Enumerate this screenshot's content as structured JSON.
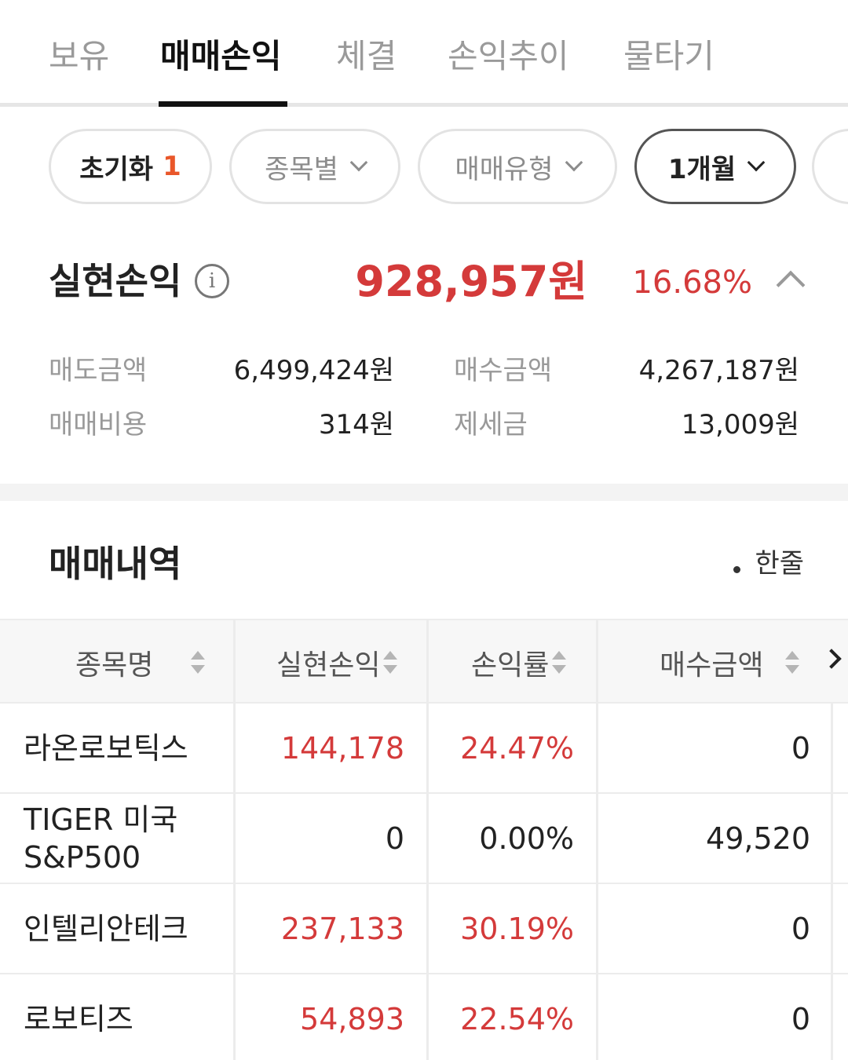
{
  "tabs": [
    {
      "label": "보유"
    },
    {
      "label": "매매손익"
    },
    {
      "label": "체결"
    },
    {
      "label": "손익추이"
    },
    {
      "label": "물타기"
    }
  ],
  "filters": {
    "reset_label": "초기화",
    "reset_count": "1",
    "by_stock": "종목별",
    "trade_type": "매매유형",
    "period": "1개월"
  },
  "summary": {
    "label": "실현손익",
    "info_glyph": "i",
    "amount": "928,957원",
    "rate": "16.68%",
    "sell_amount_label": "매도금액",
    "sell_amount": "6,499,424원",
    "buy_amount_label": "매수금액",
    "buy_amount": "4,267,187원",
    "fee_label": "매매비용",
    "fee": "314원",
    "tax_label": "제세금",
    "tax": "13,009원"
  },
  "history": {
    "title": "매매내역",
    "view_toggle": "한줄",
    "columns": [
      "종목명",
      "실현손익",
      "손익률",
      "매수금액"
    ],
    "rows": [
      {
        "name": "라온로보틱스",
        "profit": "144,178",
        "rate": "24.47%",
        "buy": "0"
      },
      {
        "name": "TIGER 미국S&P500",
        "profit": "0",
        "rate": "0.00%",
        "buy": "49,520"
      },
      {
        "name": "인텔리안테크",
        "profit": "237,133",
        "rate": "30.19%",
        "buy": "0"
      },
      {
        "name": "로보티즈",
        "profit": "54,893",
        "rate": "22.54%",
        "buy": "0"
      }
    ]
  },
  "colors": {
    "profit_red": "#d43a3a",
    "accent_orange": "#e9572a",
    "active_tab": "#111111"
  }
}
